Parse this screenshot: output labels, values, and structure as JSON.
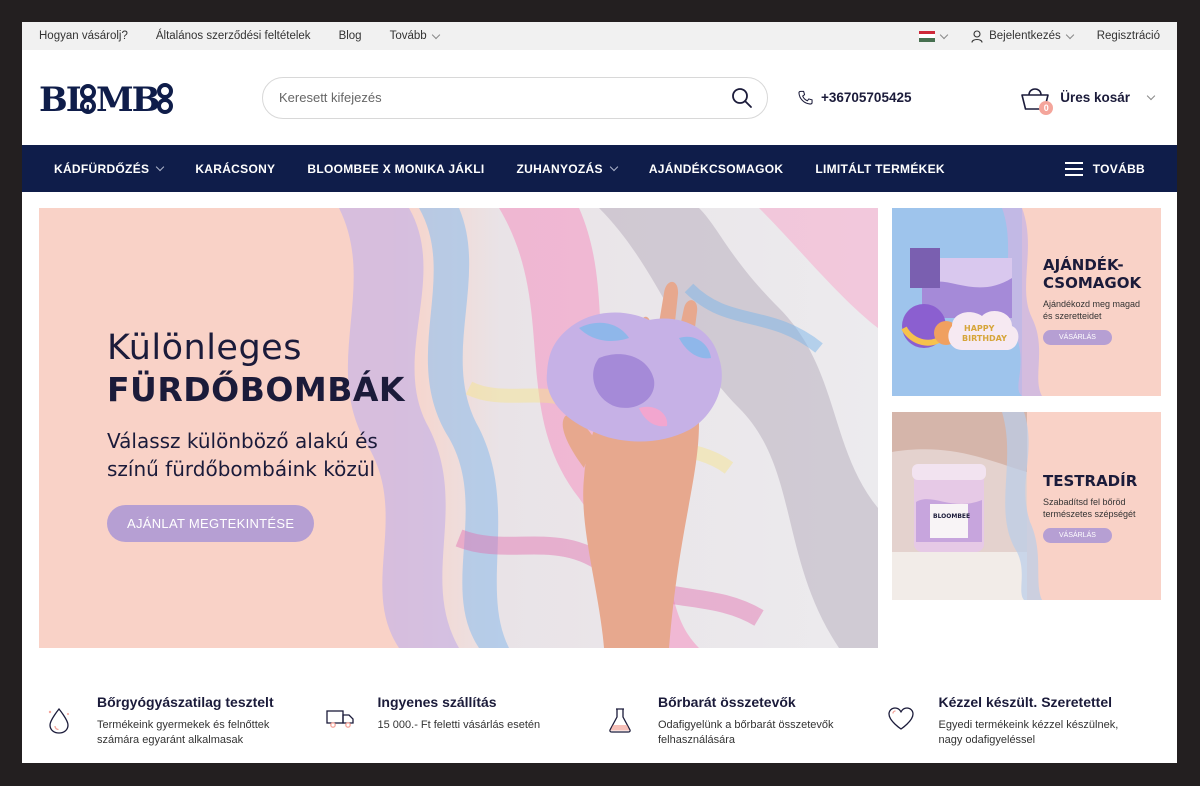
{
  "topbar": {
    "links": [
      "Hogyan vásárolj?",
      "Általános szerződési feltételek",
      "Blog",
      "Tovább"
    ],
    "login": "Bejelentkezés",
    "register": "Regisztráció"
  },
  "header": {
    "logo_text": "BLOOMBEE",
    "search_placeholder": "Keresett kifejezés",
    "phone": "+36705705425",
    "cart_label": "Üres kosár",
    "cart_count": "0"
  },
  "nav": {
    "items": [
      "KÁDFÜRDŐZÉS",
      "KARÁCSONY",
      "BLOOMBEE X MONIKA JÁKLI",
      "ZUHANYOZÁS",
      "AJÁNDÉKCSOMAGOK",
      "LIMITÁLT TERMÉKEK"
    ],
    "more": "TOVÁBB"
  },
  "hero": {
    "title1": "Különleges",
    "title2": "FÜRDŐBOMBÁK",
    "subtitle": "Válassz különböző alakú és színű fürdőbombáink közül",
    "button": "AJÁNLAT MEGTEKINTÉSE"
  },
  "side_banners": [
    {
      "title1": "AJÁNDÉK-",
      "title2": "CSOMAGOK",
      "subtitle": "Ajándékozd meg magad és szeretteidet",
      "button": "VÁSÁRLÁS",
      "card_text1": "HAPPY",
      "card_text2": "BIRTHDAY"
    },
    {
      "title1": "TESTRADÍR",
      "title2": "",
      "subtitle": "Szabadítsd fel bőröd természetes szépségét",
      "button": "VÁSÁRLÁS",
      "jar_label": "BLOOMBEE"
    }
  ],
  "features": [
    {
      "title": "Bőrgyógyászatilag tesztelt",
      "text": "Termékeink gyermekek és felnőttek számára egyaránt alkalmasak",
      "icon": "drop-icon"
    },
    {
      "title": "Ingyenes szállítás",
      "text": "15 000.- Ft feletti vásárlás esetén",
      "icon": "truck-icon"
    },
    {
      "title": "Bőrbarát összetevők",
      "text": "Odafigyelünk a bőrbarát összetevők felhasználására",
      "icon": "flask-icon"
    },
    {
      "title": "Kézzel készült. Szeretettel",
      "text": "Egyedi termékeink kézzel készülnek, nagy odafigyeléssel",
      "icon": "heart-icon"
    }
  ],
  "colors": {
    "navy": "#0f1d4a",
    "peach": "#f9d2c7",
    "lavender": "#b69fd3",
    "accent_pink": "#f4a59b"
  }
}
